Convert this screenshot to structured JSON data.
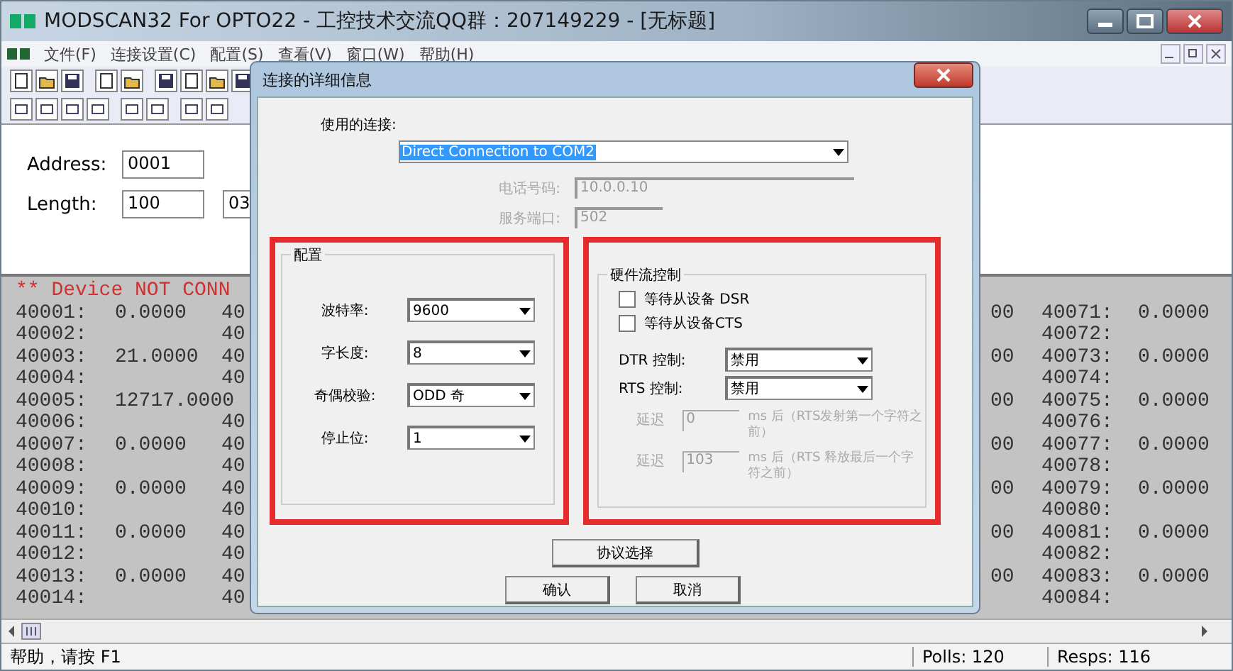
{
  "window": {
    "title": "MODSCAN32 For OPTO22 - 工控技术交流QQ群：207149229 - [无标题]"
  },
  "menu": [
    "文件(F)",
    "连接设置(C)",
    "配置(S)",
    "查看(V)",
    "窗口(W)",
    "帮助(H)"
  ],
  "address_panel": {
    "address_label": "Address:",
    "address_value": "0001",
    "length_label": "Length:",
    "length_value": "100",
    "field_3_value": "03"
  },
  "data_view": {
    "status_line": "** Device NOT CONN",
    "left_rows": [
      {
        "address": "40001:",
        "value": "0.0000",
        "column_3": "40"
      },
      {
        "address": "40002:",
        "column_3": "40"
      },
      {
        "address": "40003:",
        "value": "21.0000",
        "column_3": "40"
      },
      {
        "address": "40004:",
        "column_3": "40"
      },
      {
        "address": "40005:",
        "value": "12717.0000"
      },
      {
        "address": "40006:",
        "column_3": "40"
      },
      {
        "address": "40007:",
        "value": "0.0000",
        "column_3": "40"
      },
      {
        "address": "40008:",
        "column_3": "40"
      },
      {
        "address": "40009:",
        "value": "0.0000",
        "column_3": "40"
      },
      {
        "address": "40010:",
        "column_3": "40"
      },
      {
        "address": "40011:",
        "value": "0.0000",
        "column_3": "40"
      },
      {
        "address": "40012:",
        "column_3": "40"
      },
      {
        "address": "40013:",
        "value": "0.0000",
        "column_3": "40"
      },
      {
        "address": "40014:",
        "column_3": "40"
      }
    ],
    "right_rows": [
      {
        "column_1": "00",
        "address": "40071:",
        "value": "0.0000"
      },
      {
        "address": "40072:"
      },
      {
        "column_1": "00",
        "address": "40073:",
        "value": "0.0000"
      },
      {
        "address": "40074:"
      },
      {
        "column_1": "00",
        "address": "40075:",
        "value": "0.0000"
      },
      {
        "address": "40076:"
      },
      {
        "column_1": "00",
        "address": "40077:",
        "value": "0.0000"
      },
      {
        "address": "40078:"
      },
      {
        "column_1": "00",
        "address": "40079:",
        "value": "0.0000"
      },
      {
        "address": "40080:"
      },
      {
        "column_1": "00",
        "address": "40081:",
        "value": "0.0000"
      },
      {
        "address": "40082:"
      },
      {
        "column_1": "00",
        "address": "40083:",
        "value": "0.0000"
      },
      {
        "address": "40084:"
      }
    ]
  },
  "dialog": {
    "title": "连接的详细信息",
    "connection_label": "使用的连接:",
    "connection": {
      "value": "Direct Connection to COM2",
      "highlighted": true
    },
    "phone": {
      "label": "电话号码:",
      "value": "10.0.0.10",
      "disabled": true
    },
    "port": {
      "label": "服务端口:",
      "value": "502",
      "disabled": true
    },
    "config": {
      "title": "配置",
      "fields": [
        {
          "label": "波特率:",
          "value": "9600"
        },
        {
          "label": "字长度:",
          "value": "8"
        },
        {
          "label": "奇偶校验:",
          "value": "ODD 奇"
        },
        {
          "label": "停止位:",
          "value": "1"
        }
      ]
    },
    "flow_control": {
      "title": "硬件流控制",
      "checkboxes": [
        {
          "label": "等待从设备 DSR",
          "checked": false
        },
        {
          "label": "等待从设备CTS",
          "checked": false
        }
      ],
      "selects": [
        {
          "label": "DTR 控制:",
          "value": "禁用"
        },
        {
          "label": "RTS 控制:",
          "value": "禁用"
        }
      ],
      "delays": [
        {
          "label": "延迟",
          "value": "0",
          "note": "ms 后（RTS发射第一个字符之前）",
          "disabled": true
        },
        {
          "label": "延迟",
          "value": "103",
          "note": "ms 后（RTS 释放最后一个字符之前）",
          "disabled": true
        }
      ]
    },
    "buttons": [
      "协议选择",
      "确认",
      "取消"
    ]
  },
  "status_bar": {
    "help": "帮助，请按 F1",
    "polls": "Polls: 120",
    "resps": "Resps: 116"
  }
}
